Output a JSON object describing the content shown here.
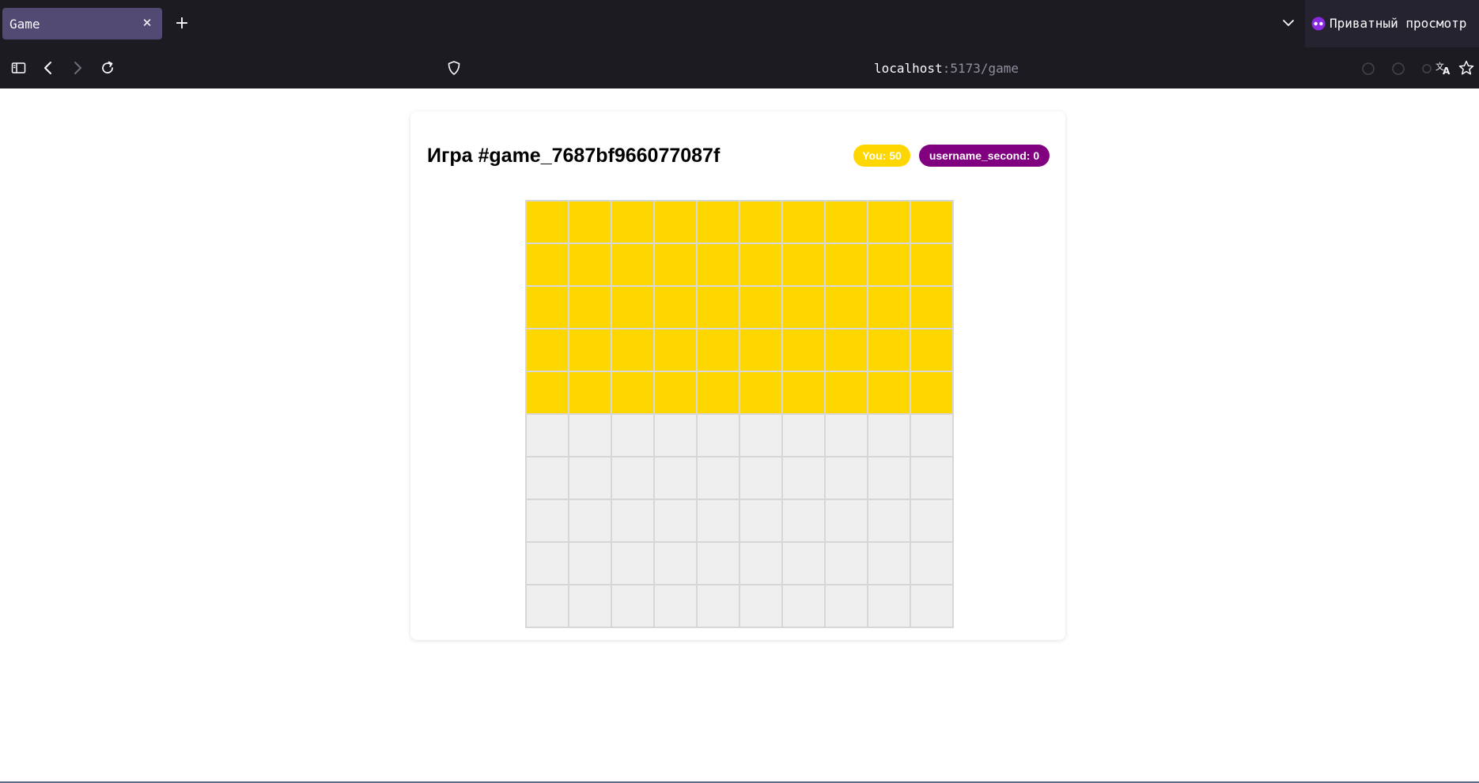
{
  "browser": {
    "tab": {
      "title": "Game"
    },
    "private_label": "Приватный просмотр",
    "url": {
      "host": "localhost",
      "rest": ":5173/game"
    }
  },
  "game": {
    "title": "Игра #game_7687bf966077087f",
    "players": {
      "you": {
        "label": "You: 50",
        "color": "#ffd700"
      },
      "opponent": {
        "label": "username_second: 0",
        "color": "#800080"
      }
    },
    "board": {
      "columns": 10,
      "rows": [
        [
          "you",
          "you",
          "you",
          "you",
          "you",
          "you",
          "you",
          "you",
          "you",
          "you"
        ],
        [
          "you",
          "you",
          "you",
          "you",
          "you",
          "you",
          "you",
          "you",
          "you",
          "you"
        ],
        [
          "you",
          "you",
          "you",
          "you",
          "you",
          "you",
          "you",
          "you",
          "you",
          "you"
        ],
        [
          "you",
          "you",
          "you",
          "you",
          "you",
          "you",
          "you",
          "you",
          "you",
          "you"
        ],
        [
          "you",
          "you",
          "you",
          "you",
          "you",
          "you",
          "you",
          "you",
          "you",
          "you"
        ],
        [
          "empty",
          "empty",
          "empty",
          "empty",
          "empty",
          "empty",
          "empty",
          "empty",
          "empty",
          "empty"
        ],
        [
          "empty",
          "empty",
          "empty",
          "empty",
          "empty",
          "empty",
          "empty",
          "empty",
          "empty",
          "empty"
        ],
        [
          "empty",
          "empty",
          "empty",
          "empty",
          "empty",
          "empty",
          "empty",
          "empty",
          "empty",
          "empty"
        ],
        [
          "empty",
          "empty",
          "empty",
          "empty",
          "empty",
          "empty",
          "empty",
          "empty",
          "empty",
          "empty"
        ],
        [
          "empty",
          "empty",
          "empty",
          "empty",
          "empty",
          "empty",
          "empty",
          "empty",
          "empty",
          "empty"
        ]
      ],
      "colors": {
        "you": "#ffd700",
        "opponent": "#800080",
        "empty": "#efefef"
      }
    }
  }
}
